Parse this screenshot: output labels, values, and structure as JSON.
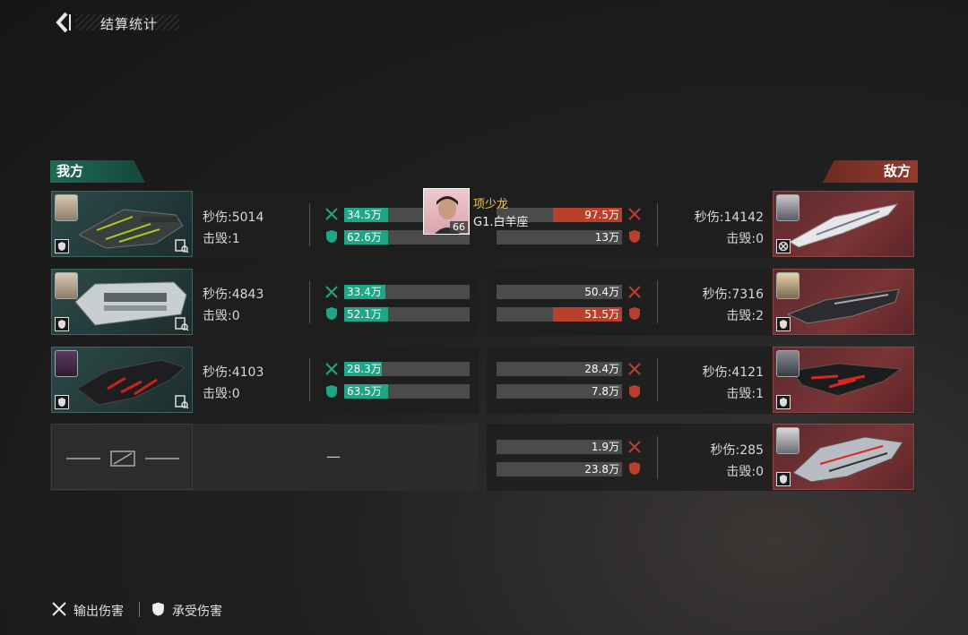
{
  "header": {
    "title": "结算统计"
  },
  "teams": {
    "ours": "我方",
    "enemy": "敌方"
  },
  "labels": {
    "dps": "秒伤:",
    "kills": "击毁:"
  },
  "ally_rows": [
    {
      "dps": "5014",
      "kills": "1",
      "damage_out": {
        "label": "34.5万",
        "fraction": 0.35
      },
      "damage_taken": {
        "label": "62.6万",
        "fraction": 0.35
      }
    },
    {
      "dps": "4843",
      "kills": "0",
      "damage_out": {
        "label": "33.4万",
        "fraction": 0.33
      },
      "damage_taken": {
        "label": "52.1万",
        "fraction": 0.35
      }
    },
    {
      "dps": "4103",
      "kills": "0",
      "damage_out": {
        "label": "28.3万",
        "fraction": 0.3
      },
      "damage_taken": {
        "label": "63.5万",
        "fraction": 0.35
      }
    }
  ],
  "empty_slot": {
    "dash": "—"
  },
  "enemy_rows": [
    {
      "dps": "14142",
      "kills": "0",
      "damage_out": {
        "label": "97.5万",
        "fraction": 0.55
      },
      "damage_taken": {
        "label": "13万",
        "fraction": 0.0
      }
    },
    {
      "dps": "7316",
      "kills": "2",
      "damage_out": {
        "label": "50.4万",
        "fraction": 0.0
      },
      "damage_taken": {
        "label": "51.5万",
        "fraction": 0.55
      }
    },
    {
      "dps": "4121",
      "kills": "1",
      "damage_out": {
        "label": "28.4万",
        "fraction": 0.0
      },
      "damage_taken": {
        "label": "7.8万",
        "fraction": 0.0
      }
    },
    {
      "dps": "285",
      "kills": "0",
      "damage_out": {
        "label": "1.9万",
        "fraction": 0.0
      },
      "damage_taken": {
        "label": "23.8万",
        "fraction": 0.0
      }
    }
  ],
  "pilot_popup": {
    "name": "项少龙",
    "subtitle": "G1.白羊座",
    "level": "66"
  },
  "legend": {
    "damage_out": "输出伤害",
    "damage_taken": "承受伤害"
  },
  "colors": {
    "ally_accent": "#1fa587",
    "enemy_accent": "#b8402c",
    "pilot_name": "#f2c94c"
  }
}
